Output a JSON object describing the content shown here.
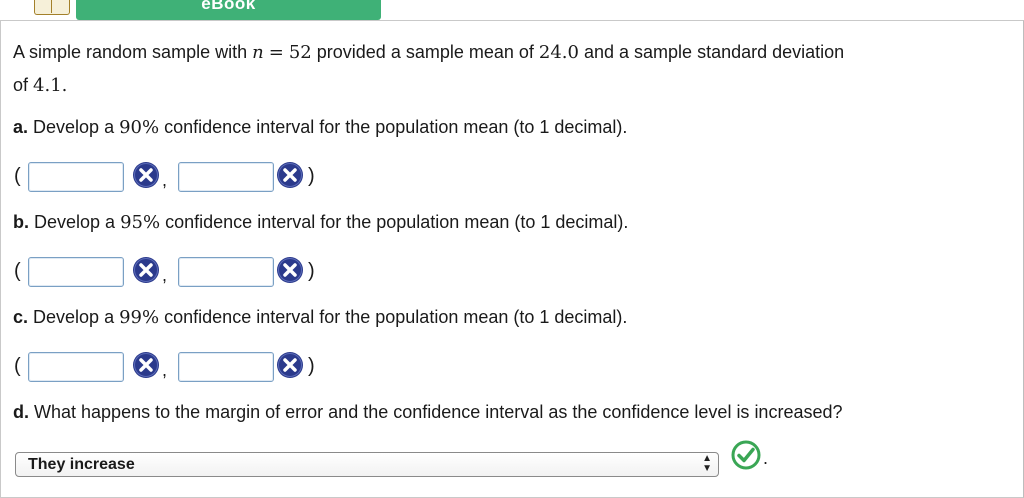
{
  "toolbar": {
    "ebook_label": "eBook"
  },
  "problem": {
    "intro_pre": "A simple random sample with",
    "n_var": "n",
    "eq": "=",
    "n_value": "52",
    "intro_mid": "provided a sample mean of",
    "mean_value": "24.0",
    "intro_mid2": "and a sample standard deviation",
    "of_text": "of",
    "sd_value": "4.1",
    "sd_end": "."
  },
  "parts": {
    "a": {
      "letter": "a.",
      "pre": "Develop a",
      "conf": "90%",
      "post": "confidence interval for the population mean (to 1 decimal)."
    },
    "b": {
      "letter": "b.",
      "pre": "Develop a",
      "conf": "95%",
      "post": "confidence interval for the population mean (to 1 decimal)."
    },
    "c": {
      "letter": "c.",
      "pre": "Develop a",
      "conf": "99%",
      "post": "confidence interval for the population mean (to 1 decimal)."
    },
    "d": {
      "letter": "d.",
      "text": "What happens to the margin of error and the confidence interval as the confidence level is increased?"
    }
  },
  "interval": {
    "open": "(",
    "close": ")",
    "comma": ","
  },
  "answers": {
    "a_lower": "",
    "a_upper": "",
    "b_lower": "",
    "b_upper": "",
    "c_lower": "",
    "c_upper": ""
  },
  "dropdown": {
    "selected": "They increase",
    "arrows": "▲▼"
  },
  "final_period": ".",
  "colors": {
    "incorrect": "#2b3a8c",
    "correct": "#3aa655",
    "ebook_bg": "#3fb177"
  }
}
